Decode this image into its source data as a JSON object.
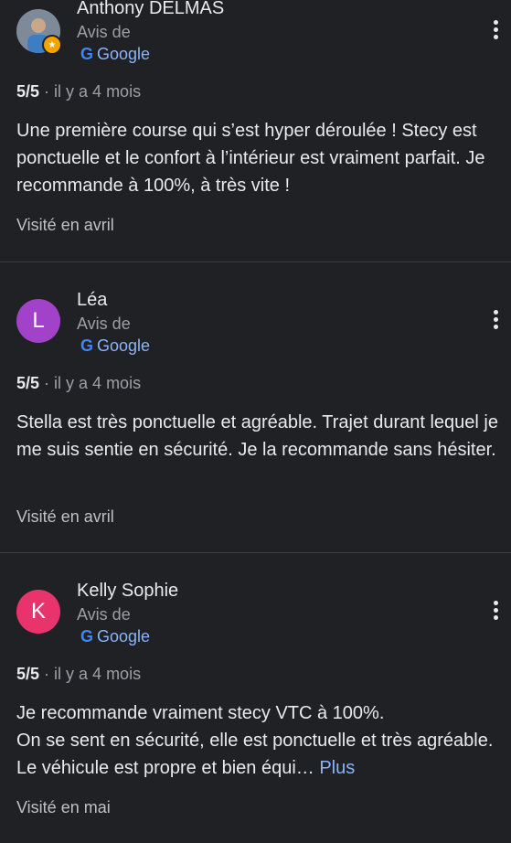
{
  "reviews": [
    {
      "name": "Anthony DELMAS",
      "avis": "Avis de",
      "google": "Google",
      "score": "5/5",
      "time": "· il y a 4 mois",
      "text": "Une première course qui s’est hyper déroulée ! Stecy est ponctuelle et le confort à l’intérieur est vraiment parfait. Je recommande à 100%, à très vite !",
      "visited": "Visité en avril"
    },
    {
      "name": "Léa",
      "initial": "L",
      "avatar_color": "#a142c8",
      "avis": "Avis de",
      "google": "Google",
      "score": "5/5",
      "time": "· il y a 4 mois",
      "text": "Stella est très ponctuelle et agréable. Trajet durant lequel je me suis sentie en sécurité. Je la recommande sans hésiter.",
      "visited": "Visité en avril"
    },
    {
      "name": "Kelly Sophie",
      "initial": "K",
      "avatar_color": "#e8336d",
      "avis": "Avis de",
      "google": "Google",
      "score": "5/5",
      "time": "· il y a 4 mois",
      "text_line1": "Je recommande vraiment stecy VTC à 100%.",
      "text_rest": "On se sent en sécurité, elle est ponctuelle et très agréable. Le véhicule est propre et bien équi…",
      "more": "Plus",
      "visited": "Visité en mai"
    }
  ]
}
